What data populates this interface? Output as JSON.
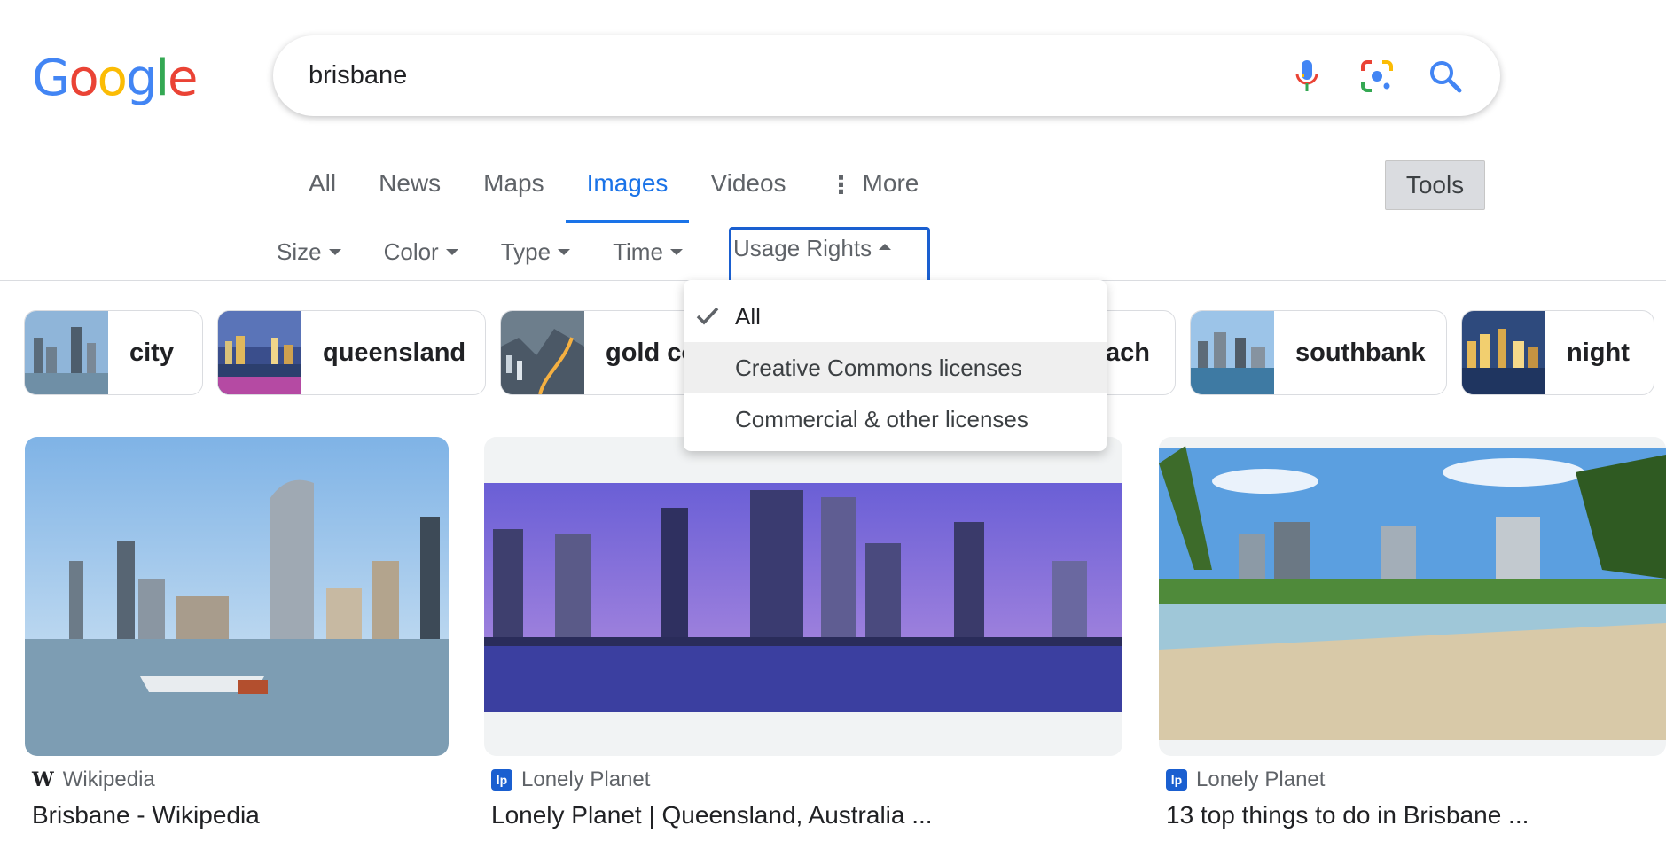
{
  "search": {
    "query": "brisbane"
  },
  "tabs": [
    {
      "label": "All"
    },
    {
      "label": "News"
    },
    {
      "label": "Maps"
    },
    {
      "label": "Images"
    },
    {
      "label": "Videos"
    },
    {
      "label": "More"
    }
  ],
  "tools_label": "Tools",
  "filters": [
    {
      "label": "Size"
    },
    {
      "label": "Color"
    },
    {
      "label": "Type"
    },
    {
      "label": "Time"
    },
    {
      "label": "Usage Rights"
    }
  ],
  "usage_dropdown": {
    "items": [
      {
        "label": "All",
        "selected": true
      },
      {
        "label": "Creative Commons licenses",
        "hovered": true
      },
      {
        "label": "Commercial & other licenses"
      }
    ]
  },
  "chips": [
    {
      "label": "city"
    },
    {
      "label": "queensland"
    },
    {
      "label": "gold co"
    },
    {
      "label": "ach"
    },
    {
      "label": "southbank"
    },
    {
      "label": "night"
    }
  ],
  "results": [
    {
      "source": "Wikipedia",
      "title": "Brisbane - Wikipedia"
    },
    {
      "source": "Lonely Planet",
      "title": "Lonely Planet | Queensland, Australia ..."
    },
    {
      "source": "Lonely Planet",
      "title": "13 top things to do in Brisbane ..."
    }
  ],
  "colors": {
    "accent": "#1a73e8",
    "focus_outline": "#1a5fd0",
    "text": "#202124",
    "muted": "#5f6368"
  }
}
